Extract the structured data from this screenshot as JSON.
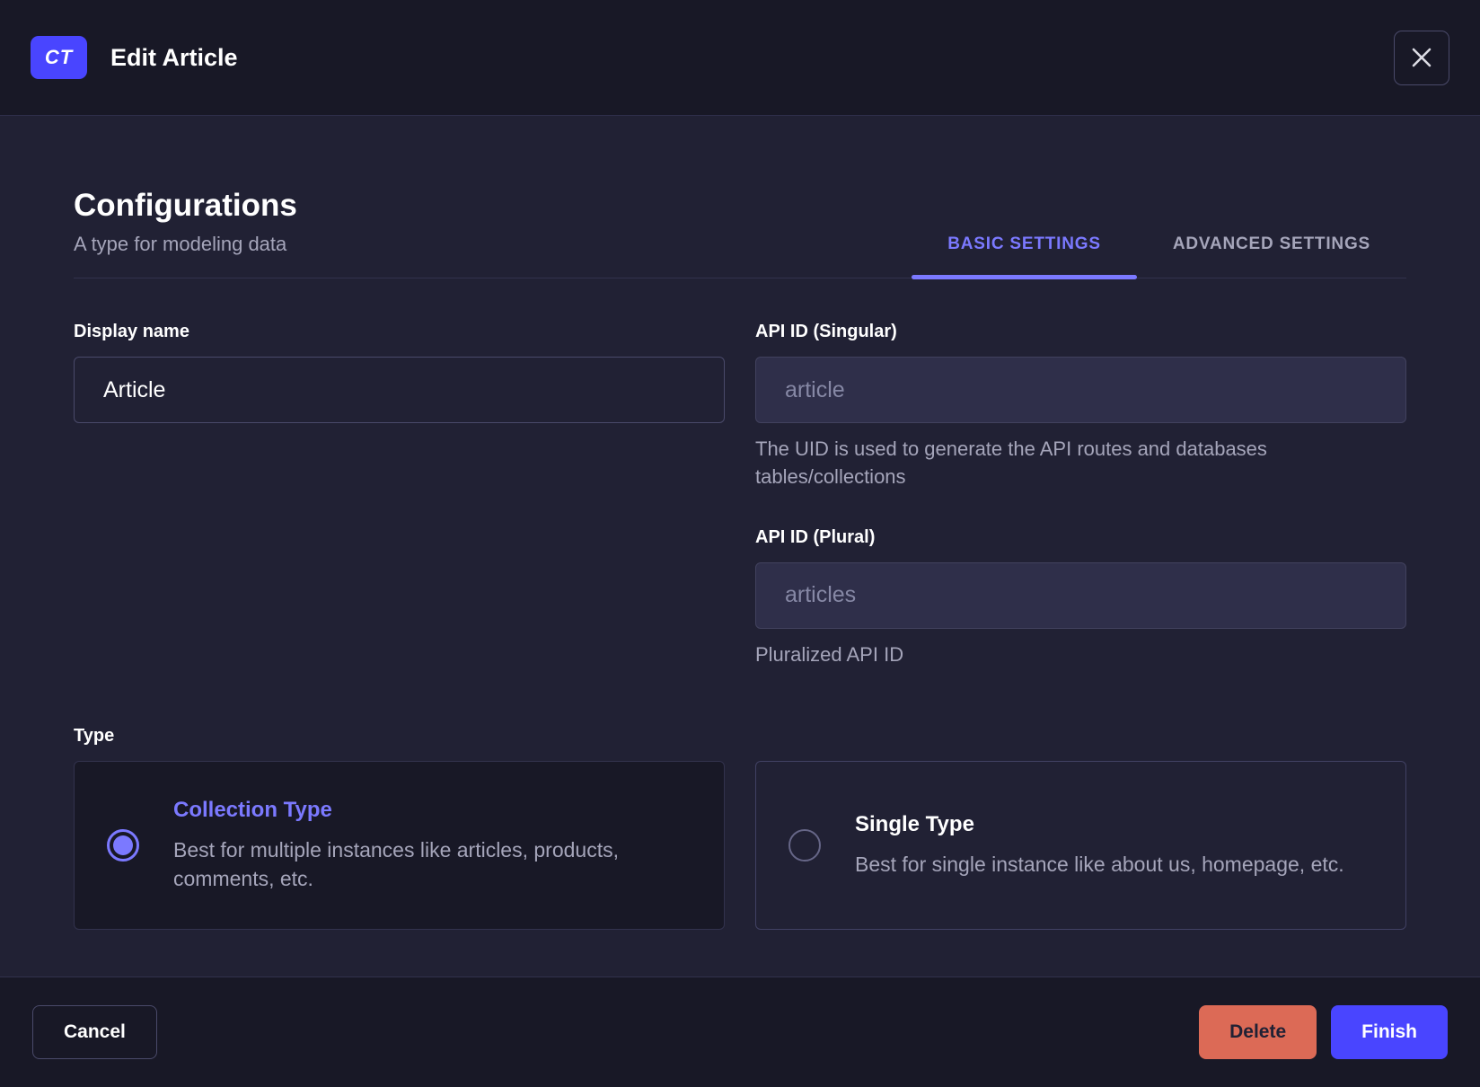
{
  "header": {
    "badge": "CT",
    "title": "Edit Article",
    "close_icon": "x-icon"
  },
  "section": {
    "title": "Configurations",
    "subtitle": "A type for modeling data",
    "tabs": [
      {
        "label": "BASIC SETTINGS",
        "active": true
      },
      {
        "label": "ADVANCED SETTINGS",
        "active": false
      }
    ]
  },
  "form": {
    "display_name": {
      "label": "Display name",
      "value": "Article"
    },
    "api_id_singular": {
      "label": "API ID (Singular)",
      "value": "article",
      "hint": "The UID is used to generate the API routes and databases tables/collections"
    },
    "api_id_plural": {
      "label": "API ID (Plural)",
      "value": "articles",
      "hint": "Pluralized API ID"
    },
    "type": {
      "label": "Type",
      "options": [
        {
          "title": "Collection Type",
          "description": "Best for multiple instances like articles, products, comments, etc.",
          "selected": true
        },
        {
          "title": "Single Type",
          "description": "Best for single instance like about us, homepage, etc.",
          "selected": false
        }
      ]
    }
  },
  "footer": {
    "cancel_label": "Cancel",
    "delete_label": "Delete",
    "finish_label": "Finish"
  },
  "colors": {
    "accent": "#4945ff",
    "accent_light": "#7b79ff",
    "danger": "#dc6a56",
    "header_bg": "#181826",
    "body_bg": "#212134"
  }
}
